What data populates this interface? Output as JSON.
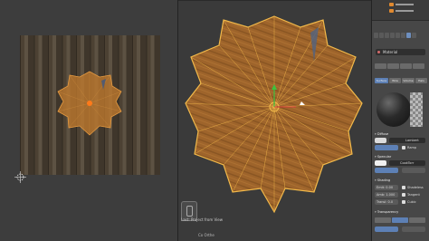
{
  "uv_editor": {
    "texture": "wood-planks",
    "cursor_icon": "crosshair-cursor-icon"
  },
  "viewport": {
    "operator_label": "Last: Project from View",
    "operator_option": "Co Orthe",
    "nav_icon": "navigation-gizmo-icon"
  },
  "properties": {
    "material_slot": "Material",
    "buttons_row1": [
      "",
      "",
      "",
      ""
    ],
    "preview_tabs": [
      "Surface",
      "Wire",
      "Volume",
      "Halo"
    ],
    "sections": {
      "diffuse": "Diffuse",
      "specular": "Specular",
      "shading": "Shading",
      "transparency": "Transparency"
    },
    "fields": {
      "intensity_label": "Intensity",
      "lambert": "Lambert",
      "cooktorr": "CookTorr",
      "ramp": "Ramp",
      "emit": "Emit: 0.00",
      "ambient": "Amb: 1.000",
      "translucency": "Transl: 0.0",
      "shadeless": "Shadeless",
      "tangent": "Tangent",
      "cubic": "Cubic"
    }
  },
  "colors": {
    "accent": "#5d80b5",
    "mesh_fill": "#c07a2e",
    "mesh_edge": "#f2b94a",
    "background": "#393939"
  }
}
